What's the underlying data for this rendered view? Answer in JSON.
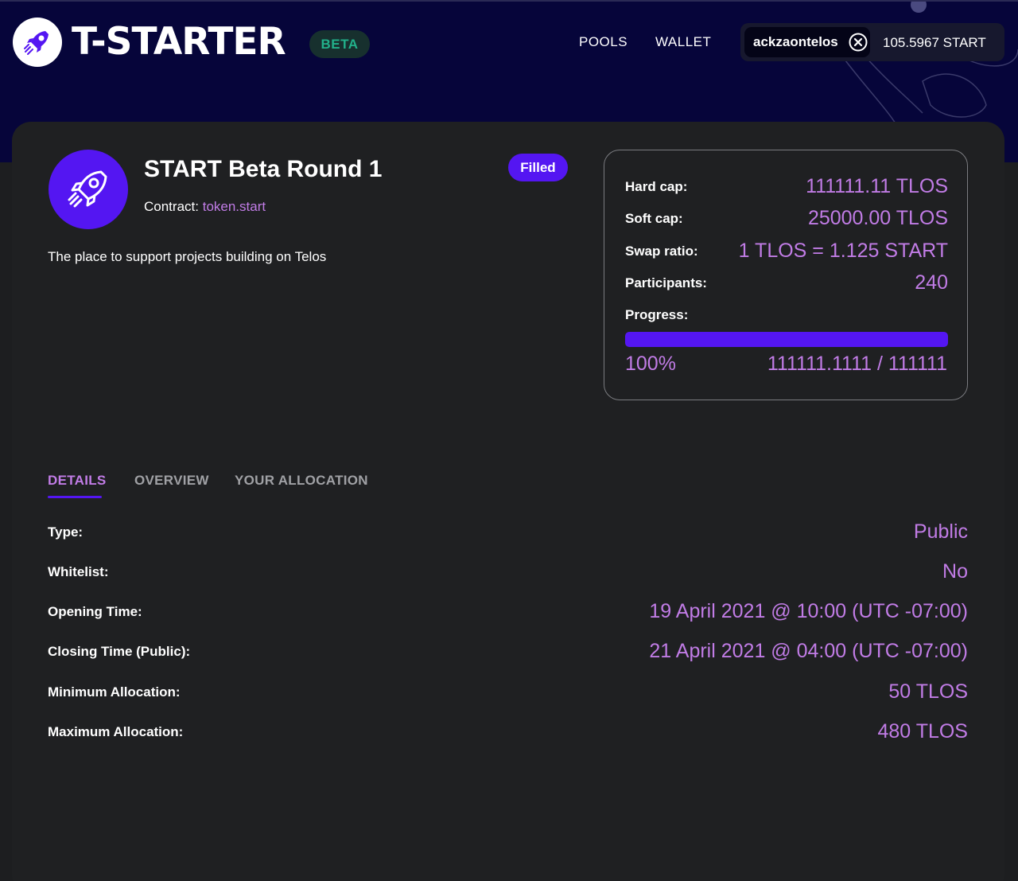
{
  "header": {
    "brand": "T-STARTER",
    "beta_label": "BETA",
    "nav": [
      "POOLS",
      "WALLET"
    ],
    "account_name": "ackzaontelos",
    "balance": "105.5967 START",
    "logout_icon": "close-circle-icon",
    "logo_icon": "rocket-icon"
  },
  "project": {
    "title": "START Beta Round 1",
    "contract_label": "Contract:",
    "contract_link": "token.start",
    "status": "Filled",
    "description": "The place to support projects building on Telos",
    "icon": "rocket-icon"
  },
  "stats": {
    "hard_cap_label": "Hard cap:",
    "hard_cap_value": "111111.11 TLOS",
    "soft_cap_label": "Soft cap:",
    "soft_cap_value": "25000.00 TLOS",
    "swap_ratio_label": "Swap ratio:",
    "swap_ratio_value": "1 TLOS = 1.125 START",
    "participants_label": "Participants:",
    "participants_value": "240",
    "progress_label": "Progress:",
    "progress_fraction": 1.0,
    "progress_percent": "100%",
    "progress_amount": "111111.1111 / 111111"
  },
  "tabs": [
    "DETAILS",
    "OVERVIEW",
    "YOUR ALLOCATION"
  ],
  "details": [
    {
      "label": "Type:",
      "value": "Public"
    },
    {
      "label": "Whitelist:",
      "value": "No"
    },
    {
      "label": "Opening Time:",
      "value": "19 April 2021 @ 10:00 (UTC -07:00)"
    },
    {
      "label": "Closing Time (Public):",
      "value": "21 April 2021 @ 04:00 (UTC -07:00)"
    },
    {
      "label": "Minimum Allocation:",
      "value": "50 TLOS"
    },
    {
      "label": "Maximum Allocation:",
      "value": "480 TLOS"
    }
  ],
  "colors": {
    "header_bg": "#06053a",
    "accent_purple": "#5416f2",
    "value_lilac": "#c17ce6",
    "beta_green": "#22b08a"
  }
}
